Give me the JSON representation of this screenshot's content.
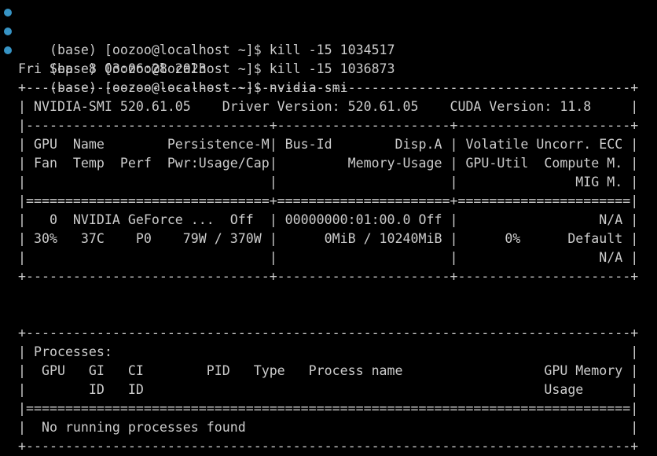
{
  "prompt_dot_color": "#3794c5",
  "text_color": "#cccccc",
  "background_color": "#000000",
  "commands": [
    "(base) [oozoo@localhost ~]$ kill -15 1034517",
    "(base) [oozoo@localhost ~]$ kill -15 1036873",
    "(base) [oozoo@localhost ~]$ nvidia-smi"
  ],
  "output": [
    "Fri Sep  8 03:06:28 2023",
    "+-----------------------------------------------------------------------------+",
    "| NVIDIA-SMI 520.61.05    Driver Version: 520.61.05    CUDA Version: 11.8     |",
    "|-------------------------------+----------------------+----------------------+",
    "| GPU  Name        Persistence-M| Bus-Id        Disp.A | Volatile Uncorr. ECC |",
    "| Fan  Temp  Perf  Pwr:Usage/Cap|         Memory-Usage | GPU-Util  Compute M. |",
    "|                               |                      |               MIG M. |",
    "|===============================+======================+======================|",
    "|   0  NVIDIA GeForce ...  Off  | 00000000:01:00.0 Off |                  N/A |",
    "| 30%   37C    P0    79W / 370W |      0MiB / 10240MiB |      0%      Default |",
    "|                               |                      |                  N/A |",
    "+-------------------------------+----------------------+----------------------+",
    "",
    "",
    "+-----------------------------------------------------------------------------+",
    "| Processes:                                                                  |",
    "|  GPU   GI   CI        PID   Type   Process name                  GPU Memory |",
    "|        ID   ID                                                   Usage      |",
    "|=============================================================================|",
    "|  No running processes found                                                 |",
    "+-----------------------------------------------------------------------------+"
  ]
}
